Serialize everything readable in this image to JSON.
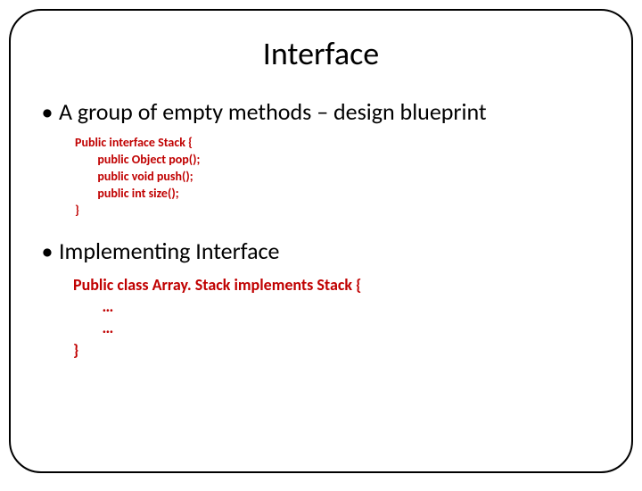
{
  "slide": {
    "title": "Interface",
    "bullet1": "A group of empty methods – design blueprint",
    "code1": "Public interface Stack {\n        public Object pop();\n        public void push();\n        public int size();\n}",
    "bullet2": "Implementing Interface",
    "code2": "Public class Array. Stack implements Stack {\n        …\n        …\n}"
  }
}
